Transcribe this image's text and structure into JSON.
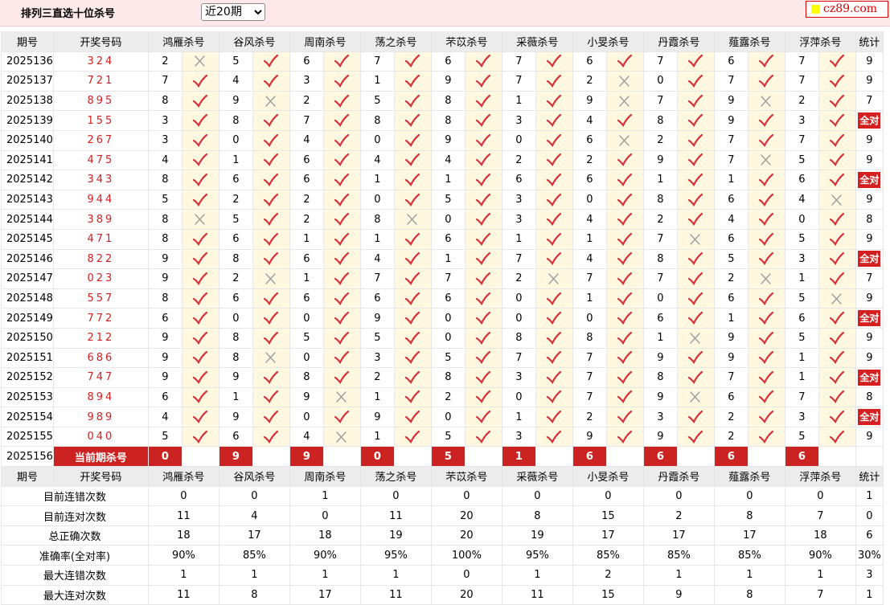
{
  "header": {
    "title": "排列三直选十位杀号",
    "period_select": {
      "selected": "近20期",
      "options": [
        "近20期"
      ]
    },
    "brand": "cz89.com"
  },
  "columns": {
    "period": "期号",
    "draw": "开奖号码",
    "experts": [
      "鸿雁杀号",
      "谷风杀号",
      "周南杀号",
      "荡之杀号",
      "芣苡杀号",
      "采薇杀号",
      "小旻杀号",
      "丹霞杀号",
      "薤露杀号",
      "浮萍杀号"
    ],
    "stat": "统计"
  },
  "rows": [
    {
      "period": "2025136",
      "draw": "324",
      "picks": [
        2,
        5,
        6,
        7,
        6,
        7,
        6,
        7,
        6,
        7
      ],
      "ok": [
        false,
        true,
        true,
        true,
        true,
        true,
        true,
        true,
        true,
        true
      ],
      "stat": "9"
    },
    {
      "period": "2025137",
      "draw": "721",
      "picks": [
        7,
        4,
        3,
        1,
        9,
        7,
        2,
        0,
        7,
        7
      ],
      "ok": [
        true,
        true,
        true,
        true,
        true,
        true,
        false,
        true,
        true,
        true
      ],
      "stat": "9"
    },
    {
      "period": "2025138",
      "draw": "895",
      "picks": [
        8,
        9,
        2,
        5,
        8,
        1,
        9,
        7,
        9,
        2
      ],
      "ok": [
        true,
        false,
        true,
        true,
        true,
        true,
        false,
        true,
        false,
        true
      ],
      "stat": "7"
    },
    {
      "period": "2025139",
      "draw": "155",
      "picks": [
        3,
        8,
        7,
        8,
        8,
        3,
        4,
        8,
        9,
        3
      ],
      "ok": [
        true,
        true,
        true,
        true,
        true,
        true,
        true,
        true,
        true,
        true
      ],
      "stat": "全对"
    },
    {
      "period": "2025140",
      "draw": "267",
      "picks": [
        3,
        0,
        4,
        0,
        9,
        0,
        6,
        2,
        7,
        7
      ],
      "ok": [
        true,
        true,
        true,
        true,
        true,
        true,
        false,
        true,
        true,
        true
      ],
      "stat": "9"
    },
    {
      "period": "2025141",
      "draw": "475",
      "picks": [
        4,
        1,
        6,
        4,
        4,
        2,
        2,
        9,
        7,
        5
      ],
      "ok": [
        true,
        true,
        true,
        true,
        true,
        true,
        true,
        true,
        false,
        true
      ],
      "stat": "9"
    },
    {
      "period": "2025142",
      "draw": "343",
      "picks": [
        8,
        6,
        6,
        1,
        1,
        6,
        6,
        1,
        1,
        6
      ],
      "ok": [
        true,
        true,
        true,
        true,
        true,
        true,
        true,
        true,
        true,
        true
      ],
      "stat": "全对"
    },
    {
      "period": "2025143",
      "draw": "944",
      "picks": [
        5,
        2,
        2,
        0,
        5,
        3,
        0,
        8,
        6,
        4
      ],
      "ok": [
        true,
        true,
        true,
        true,
        true,
        true,
        true,
        true,
        true,
        false
      ],
      "stat": "9"
    },
    {
      "period": "2025144",
      "draw": "389",
      "picks": [
        8,
        5,
        2,
        8,
        0,
        3,
        4,
        2,
        4,
        0
      ],
      "ok": [
        false,
        true,
        true,
        false,
        true,
        true,
        true,
        true,
        true,
        true
      ],
      "stat": "8"
    },
    {
      "period": "2025145",
      "draw": "471",
      "picks": [
        8,
        6,
        1,
        1,
        6,
        1,
        1,
        7,
        6,
        5
      ],
      "ok": [
        true,
        true,
        true,
        true,
        true,
        true,
        true,
        false,
        true,
        true
      ],
      "stat": "9"
    },
    {
      "period": "2025146",
      "draw": "822",
      "picks": [
        9,
        8,
        6,
        4,
        1,
        7,
        4,
        8,
        5,
        3
      ],
      "ok": [
        true,
        true,
        true,
        true,
        true,
        true,
        true,
        true,
        true,
        true
      ],
      "stat": "全对"
    },
    {
      "period": "2025147",
      "draw": "023",
      "picks": [
        9,
        2,
        1,
        7,
        7,
        2,
        7,
        7,
        2,
        1
      ],
      "ok": [
        true,
        false,
        true,
        true,
        true,
        false,
        true,
        true,
        false,
        true
      ],
      "stat": "7"
    },
    {
      "period": "2025148",
      "draw": "557",
      "picks": [
        8,
        6,
        6,
        6,
        6,
        0,
        1,
        0,
        6,
        5
      ],
      "ok": [
        true,
        true,
        true,
        true,
        true,
        true,
        true,
        true,
        true,
        false
      ],
      "stat": "9"
    },
    {
      "period": "2025149",
      "draw": "772",
      "picks": [
        6,
        0,
        0,
        9,
        0,
        0,
        0,
        6,
        1,
        6
      ],
      "ok": [
        true,
        true,
        true,
        true,
        true,
        true,
        true,
        true,
        true,
        true
      ],
      "stat": "全对"
    },
    {
      "period": "2025150",
      "draw": "212",
      "picks": [
        9,
        8,
        5,
        5,
        0,
        8,
        8,
        1,
        9,
        5
      ],
      "ok": [
        true,
        true,
        true,
        true,
        true,
        true,
        true,
        false,
        true,
        true
      ],
      "stat": "9"
    },
    {
      "period": "2025151",
      "draw": "686",
      "picks": [
        9,
        8,
        0,
        3,
        5,
        7,
        7,
        9,
        9,
        1
      ],
      "ok": [
        true,
        false,
        true,
        true,
        true,
        true,
        true,
        true,
        true,
        true
      ],
      "stat": "9"
    },
    {
      "period": "2025152",
      "draw": "747",
      "picks": [
        9,
        9,
        8,
        2,
        8,
        3,
        7,
        8,
        7,
        1
      ],
      "ok": [
        true,
        true,
        true,
        true,
        true,
        true,
        true,
        true,
        true,
        true
      ],
      "stat": "全对"
    },
    {
      "period": "2025153",
      "draw": "894",
      "picks": [
        6,
        1,
        9,
        1,
        2,
        0,
        7,
        9,
        6,
        7
      ],
      "ok": [
        true,
        true,
        false,
        true,
        true,
        true,
        true,
        false,
        true,
        true
      ],
      "stat": "8"
    },
    {
      "period": "2025154",
      "draw": "989",
      "picks": [
        4,
        9,
        0,
        9,
        0,
        1,
        2,
        3,
        2,
        3
      ],
      "ok": [
        true,
        true,
        true,
        true,
        true,
        true,
        true,
        true,
        true,
        true
      ],
      "stat": "全对"
    },
    {
      "period": "2025155",
      "draw": "040",
      "picks": [
        5,
        6,
        4,
        1,
        5,
        3,
        9,
        9,
        2,
        5
      ],
      "ok": [
        true,
        true,
        false,
        true,
        true,
        true,
        true,
        true,
        true,
        true
      ],
      "stat": "9"
    }
  ],
  "current": {
    "period": "2025156",
    "label": "当前期杀号",
    "picks": [
      0,
      9,
      9,
      0,
      5,
      1,
      6,
      6,
      6,
      6
    ]
  },
  "summary": {
    "rows": [
      {
        "label": "目前连错次数",
        "values": [
          "0",
          "0",
          "1",
          "0",
          "0",
          "0",
          "0",
          "0",
          "0",
          "0"
        ],
        "stat": "1"
      },
      {
        "label": "目前连对次数",
        "values": [
          "11",
          "4",
          "0",
          "11",
          "20",
          "8",
          "15",
          "2",
          "8",
          "7"
        ],
        "stat": "0"
      },
      {
        "label": "总正确次数",
        "values": [
          "18",
          "17",
          "18",
          "19",
          "20",
          "19",
          "17",
          "17",
          "17",
          "18"
        ],
        "stat": "6"
      },
      {
        "label": "准确率(全对率)",
        "values": [
          "90%",
          "85%",
          "90%",
          "95%",
          "100%",
          "95%",
          "85%",
          "85%",
          "85%",
          "90%"
        ],
        "stat": "30%",
        "pct": true
      },
      {
        "label": "最大连错次数",
        "values": [
          "1",
          "1",
          "1",
          "1",
          "0",
          "1",
          "2",
          "1",
          "1",
          "1"
        ],
        "stat": "3"
      },
      {
        "label": "最大连对次数",
        "values": [
          "11",
          "8",
          "17",
          "11",
          "20",
          "11",
          "15",
          "9",
          "8",
          "7"
        ],
        "stat": "1"
      }
    ]
  },
  "colors": {
    "accent_red": "#d42020",
    "blue_num": "#1a3fbf",
    "check": "#d9303a",
    "cross": "#9a9a9a",
    "result_bg": "#fdf8df"
  },
  "icons": {
    "correct": "check-mark-icon",
    "wrong": "cross-mark-icon"
  }
}
